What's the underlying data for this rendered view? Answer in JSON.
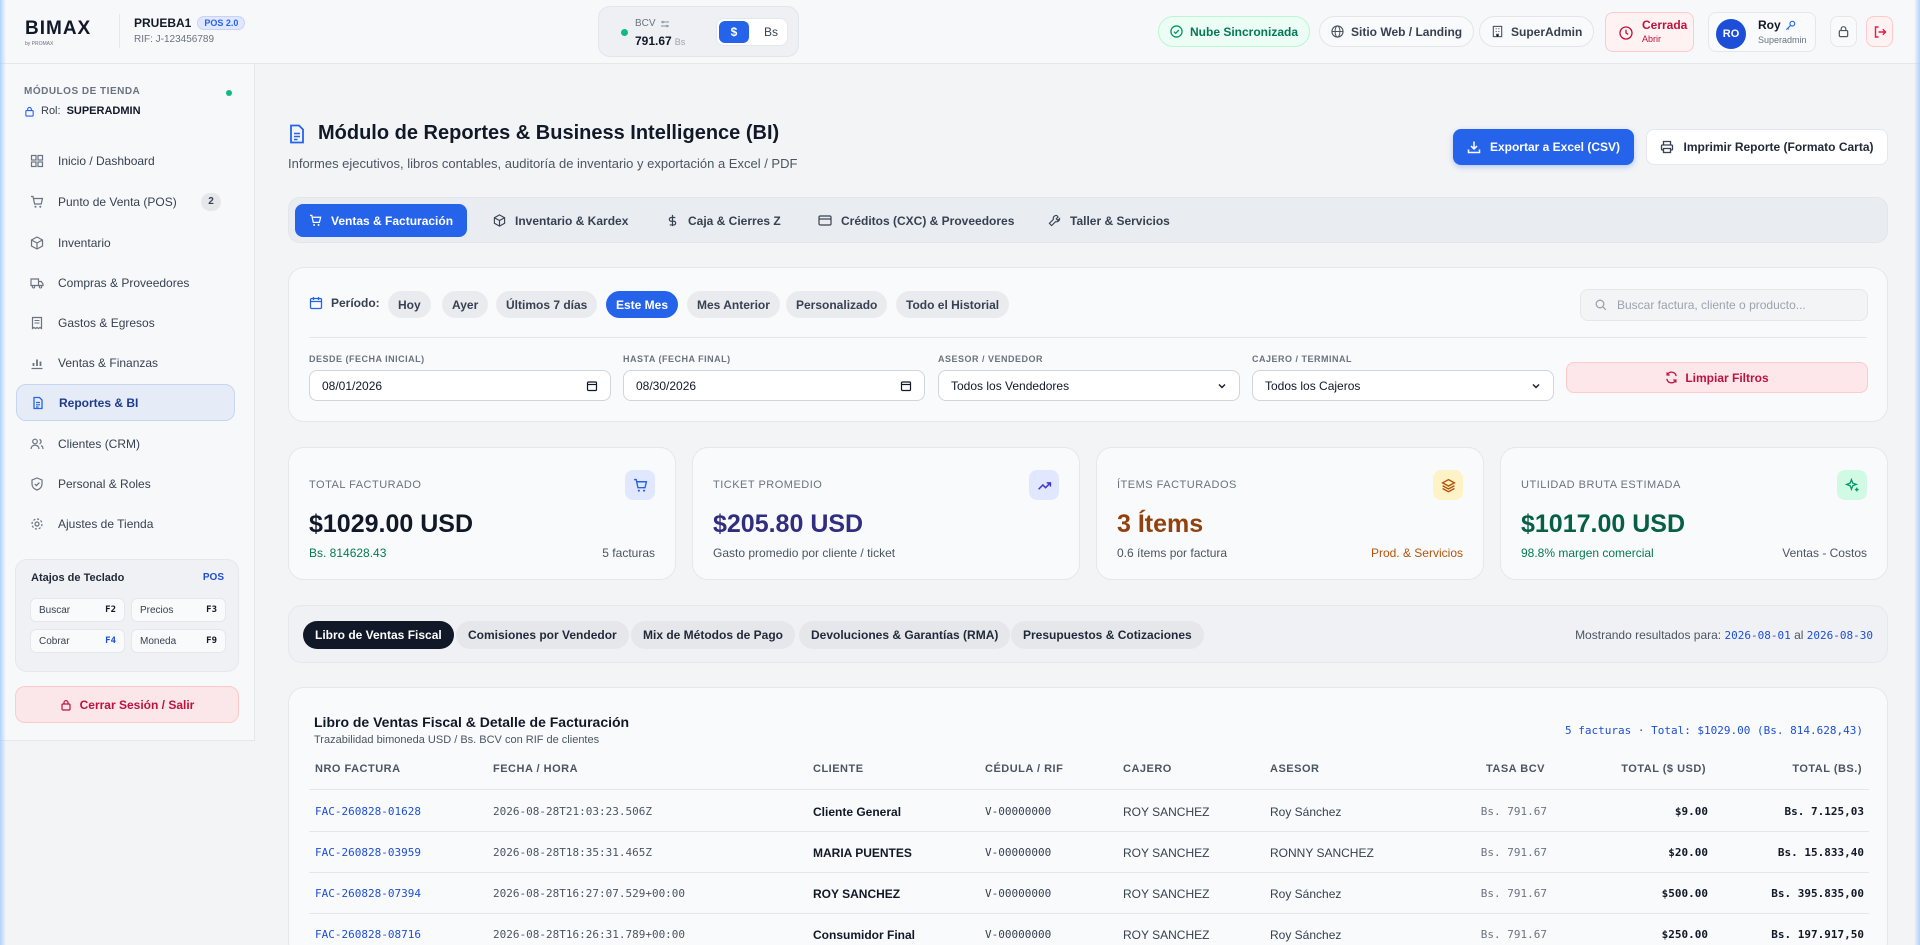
{
  "brand": {
    "logo_text": "BIMAX",
    "logo_tagline": "by PROMAX"
  },
  "store": {
    "name": "PRUEBA1",
    "badge": "POS 2.0",
    "rif": "RIF: J-123456789"
  },
  "exchange": {
    "label": "BCV",
    "rate": "791.67",
    "unit": "Bs",
    "currency_usd": "$",
    "currency_bs": "Bs",
    "active_currency": "usd"
  },
  "topbar": {
    "sync_label": "Nube Sincronizada",
    "landing_label": "Sitio Web / Landing",
    "superadmin_label": "SuperAdmin",
    "cash_status": "Cerrada",
    "cash_action": "Abrir"
  },
  "user": {
    "initials": "RO",
    "name": "Roy",
    "role": "Superadmin"
  },
  "sidebar": {
    "heading": "MÓDULOS DE TIENDA",
    "role_label": "Rol:",
    "role_value": "SUPERADMIN",
    "items": [
      {
        "label": "Inicio / Dashboard",
        "icon": "dashboard-icon"
      },
      {
        "label": "Punto de Venta (POS)",
        "icon": "cart-icon",
        "badge": "2"
      },
      {
        "label": "Inventario",
        "icon": "box-icon"
      },
      {
        "label": "Compras & Proveedores",
        "icon": "truck-icon"
      },
      {
        "label": "Gastos & Egresos",
        "icon": "receipt-icon"
      },
      {
        "label": "Ventas & Finanzas",
        "icon": "chart-icon"
      },
      {
        "label": "Reportes & BI",
        "icon": "report-icon",
        "active": true
      },
      {
        "label": "Clientes (CRM)",
        "icon": "users-icon"
      },
      {
        "label": "Personal & Roles",
        "icon": "shield-icon"
      },
      {
        "label": "Ajustes de Tienda",
        "icon": "gear-icon"
      }
    ],
    "shortcuts": {
      "title": "Atajos de Teclado",
      "badge": "POS",
      "keys": [
        {
          "label": "Buscar",
          "key": "F2"
        },
        {
          "label": "Precios",
          "key": "F3"
        },
        {
          "label": "Cobrar",
          "key": "F4"
        },
        {
          "label": "Moneda",
          "key": "F9"
        }
      ]
    },
    "logout_label": "Cerrar Sesión / Salir"
  },
  "page": {
    "title": "Módulo de Reportes & Business Intelligence (BI)",
    "subtitle": "Informes ejecutivos, libros contables, auditoría de inventario y exportación a Excel / PDF",
    "export_label": "Exportar a Excel (CSV)",
    "print_label": "Imprimir Reporte (Formato Carta)"
  },
  "module_tabs": [
    {
      "label": "Ventas & Facturación",
      "icon": "cart-icon",
      "active": true
    },
    {
      "label": "Inventario & Kardex",
      "icon": "box-icon"
    },
    {
      "label": "Caja & Cierres Z",
      "icon": "dollar-icon"
    },
    {
      "label": "Créditos (CXC) & Proveedores",
      "icon": "card-icon"
    },
    {
      "label": "Taller & Servicios",
      "icon": "wrench-icon"
    }
  ],
  "filters": {
    "period_label": "Período:",
    "periods": [
      {
        "label": "Hoy"
      },
      {
        "label": "Ayer"
      },
      {
        "label": "Últimos 7 días"
      },
      {
        "label": "Este Mes",
        "active": true
      },
      {
        "label": "Mes Anterior"
      },
      {
        "label": "Personalizado"
      },
      {
        "label": "Todo el Historial"
      }
    ],
    "search_placeholder": "Buscar factura, cliente o producto...",
    "from_label": "DESDE (FECHA INICIAL)",
    "from_value": "08/01/2026",
    "to_label": "HASTA (FECHA FINAL)",
    "to_value": "08/30/2026",
    "seller_label": "ASESOR / VENDEDOR",
    "seller_value": "Todos los Vendedores",
    "cashier_label": "CAJERO / TERMINAL",
    "cashier_value": "Todos los Cajeros",
    "clear_label": "Limpiar Filtros"
  },
  "kpis": [
    {
      "label": "TOTAL FACTURADO",
      "value": "$1029.00 USD",
      "sub_left": "Bs. 814628.43",
      "sub_right": "5 facturas",
      "icon": "cart-icon",
      "color": "#111827"
    },
    {
      "label": "TICKET PROMEDIO",
      "value": "$205.80 USD",
      "sub_left": "Gasto promedio por cliente / ticket",
      "sub_right": "",
      "icon": "trend-up-icon",
      "color": "#312e81"
    },
    {
      "label": "ÍTEMS FACTURADOS",
      "value": "3 Ítems",
      "sub_left": "0.6 ítems por factura",
      "sub_right": "Prod. & Servicios",
      "icon": "layers-icon",
      "color": "#92400e"
    },
    {
      "label": "UTILIDAD BRUTA ESTIMADA",
      "value": "$1017.00 USD",
      "sub_left": "98.8% margen comercial",
      "sub_right": "Ventas - Costos",
      "icon": "sparkle-icon",
      "color": "#065f46"
    }
  ],
  "report_tabs": [
    {
      "label": "Libro de Ventas Fiscal",
      "active": true
    },
    {
      "label": "Comisiones por Vendedor"
    },
    {
      "label": "Mix de Métodos de Pago"
    },
    {
      "label": "Devoluciones & Garantías (RMA)"
    },
    {
      "label": "Presupuestos & Cotizaciones"
    }
  ],
  "showing": {
    "prefix": "Mostrando resultados para:",
    "from": "2026-08-01",
    "mid": "al",
    "to": "2026-08-30"
  },
  "table": {
    "title": "Libro de Ventas Fiscal & Detalle de Facturación",
    "subtitle": "Trazabilidad bimoneda USD / Bs. BCV con RIF de clientes",
    "summary": "5 facturas · Total: $1029.00 (Bs. 814.628,43)",
    "columns": [
      "NRO FACTURA",
      "FECHA / HORA",
      "CLIENTE",
      "CÉDULA / RIF",
      "CAJERO",
      "ASESOR",
      "TASA BCV",
      "TOTAL ($ USD)",
      "TOTAL (BS.)"
    ],
    "rows": [
      [
        "FAC-260828-01628",
        "2026-08-28T21:03:23.506Z",
        "Cliente General",
        "V-00000000",
        "ROY SANCHEZ",
        "Roy Sánchez",
        "Bs. 791.67",
        "$9.00",
        "Bs. 7.125,03"
      ],
      [
        "FAC-260828-03959",
        "2026-08-28T18:35:31.465Z",
        "MARIA PUENTES",
        "V-00000000",
        "ROY SANCHEZ",
        "RONNY SANCHEZ",
        "Bs. 791.67",
        "$20.00",
        "Bs. 15.833,40"
      ],
      [
        "FAC-260828-07394",
        "2026-08-28T16:27:07.529+00:00",
        "ROY SANCHEZ",
        "V-00000000",
        "ROY SANCHEZ",
        "Roy Sánchez",
        "Bs. 791.67",
        "$500.00",
        "Bs. 395.835,00"
      ],
      [
        "FAC-260828-08716",
        "2026-08-28T16:26:31.789+00:00",
        "Consumidor Final",
        "V-00000000",
        "ROY SANCHEZ",
        "Roy Sánchez",
        "Bs. 791.67",
        "$250.00",
        "Bs. 197.917,50"
      ]
    ]
  }
}
